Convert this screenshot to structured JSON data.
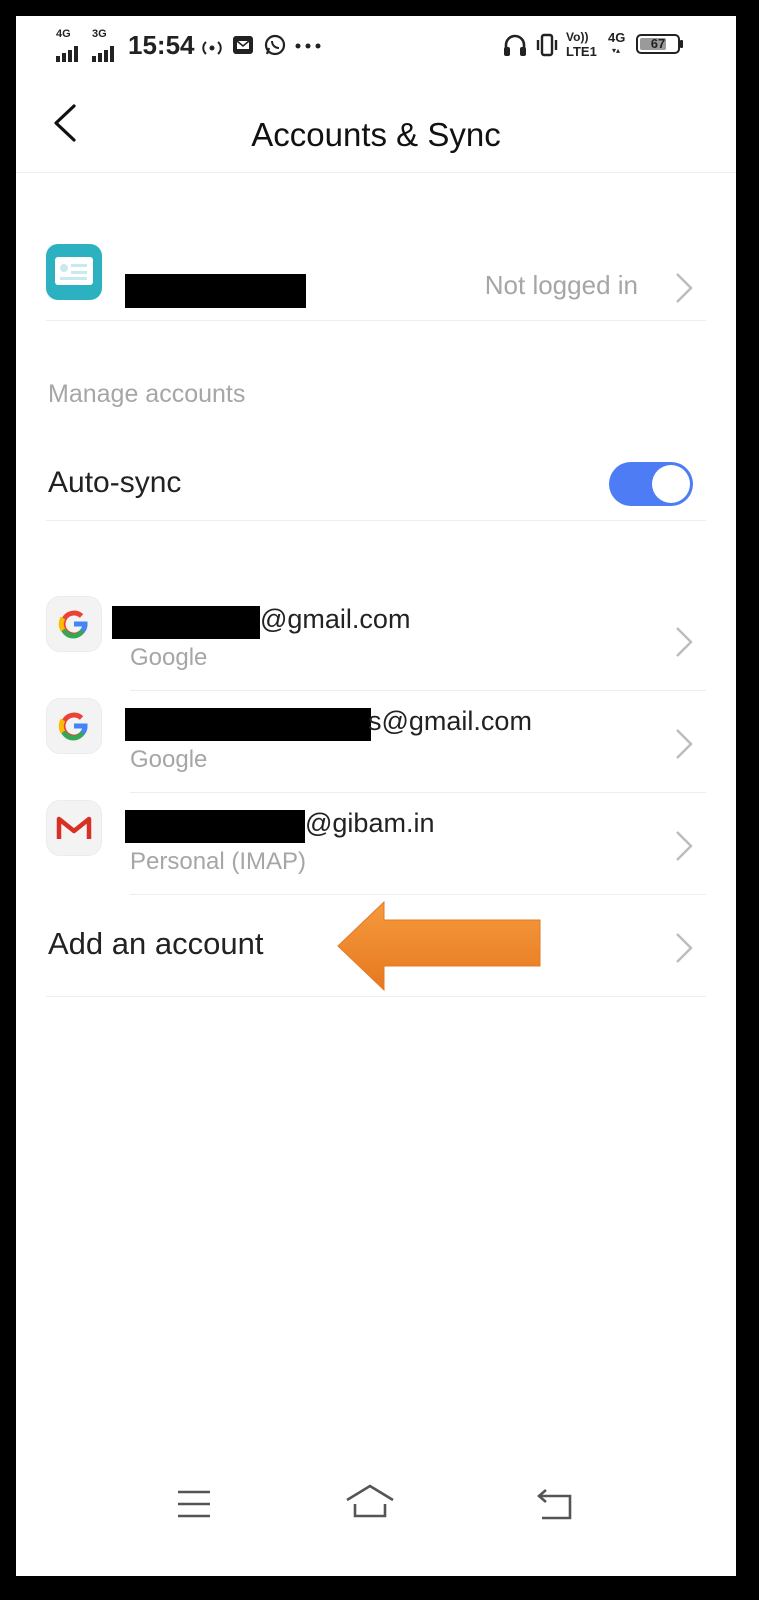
{
  "status_bar": {
    "network_1": "4G",
    "network_2": "3G",
    "time": "15:54",
    "volte": "Vo))",
    "lte": "LTE1",
    "network_3": "4G",
    "battery": "67"
  },
  "header": {
    "title": "Accounts & Sync"
  },
  "profile": {
    "status": "Not logged in"
  },
  "section": {
    "manage_label": "Manage accounts",
    "autosync_label": "Auto-sync",
    "autosync_on": true,
    "accent_color": "#4d7cf5"
  },
  "accounts": [
    {
      "email_suffix": "@gmail.com",
      "type": "Google",
      "icon": "google-icon"
    },
    {
      "email_suffix": "s@gmail.com",
      "type": "Google",
      "icon": "google-icon"
    },
    {
      "email_suffix": "@gibam.in",
      "type": "Personal (IMAP)",
      "icon": "gmail-icon"
    }
  ],
  "add_account": {
    "label": "Add an account",
    "arrow_color": "#f0872b"
  },
  "nav": {
    "menu_icon": "menu-icon",
    "home_icon": "home-icon",
    "back_icon": "back-icon"
  }
}
